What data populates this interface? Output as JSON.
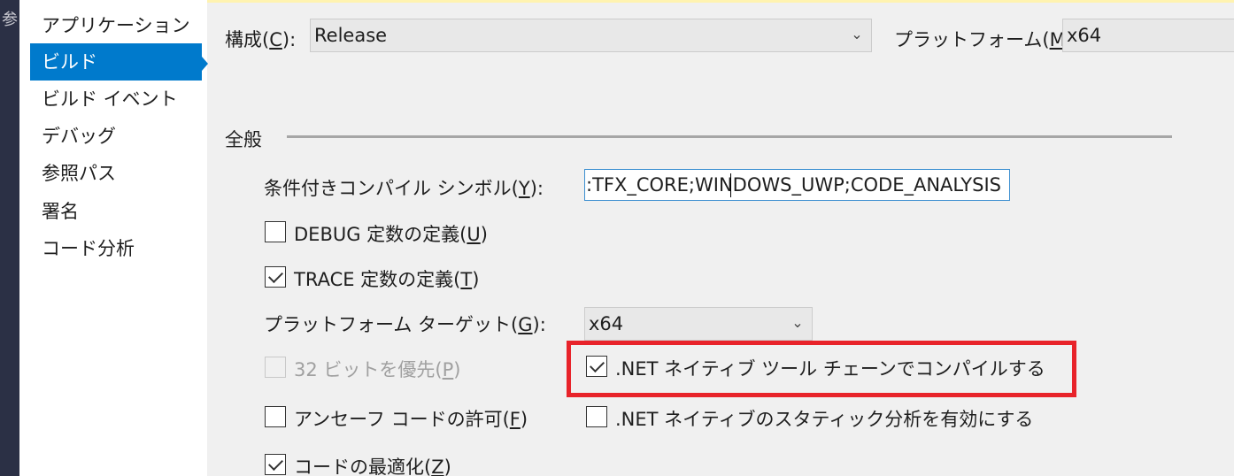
{
  "sidebar": {
    "items": [
      {
        "label": "アプリケーション"
      },
      {
        "label": "ビルド"
      },
      {
        "label": "ビルド イベント"
      },
      {
        "label": "デバッグ"
      },
      {
        "label": "参照パス"
      },
      {
        "label": "署名"
      },
      {
        "label": "コード分析"
      }
    ],
    "selected": "ビルド"
  },
  "left_strip": {
    "glyph": "参"
  },
  "toolbar": {
    "config_label": "構成(",
    "config_key": "C",
    "config_label_end": "):",
    "config_value": "Release",
    "platform_label": "プラットフォーム(",
    "platform_key": "M",
    "platform_label_end": "):",
    "platform_value": "x64"
  },
  "general": {
    "section_title": "全般",
    "symbols_label": "条件付きコンパイル シンボル(",
    "symbols_key": "Y",
    "symbols_label_end": "):",
    "symbols_value": ":TFX_CORE;WINDOWS_UWP;CODE_ANALYSIS",
    "debug_label": "DEBUG 定数の定義(",
    "debug_key": "U",
    "debug_label_end": ")",
    "debug_checked": false,
    "trace_label": "TRACE 定数の定義(",
    "trace_key": "T",
    "trace_label_end": ")",
    "trace_checked": true,
    "target_label": "プラットフォーム ターゲット(",
    "target_key": "G",
    "target_label_end": "):",
    "target_value": "x64",
    "prefer32_label": "32 ビットを優先(",
    "prefer32_key": "P",
    "prefer32_label_end": ")",
    "prefer32_checked": false,
    "prefer32_enabled": false,
    "native_label": ".NET ネイティブ ツール チェーンでコンパイルする",
    "native_checked": true,
    "unsafe_label": "アンセーフ コードの許可(",
    "unsafe_key": "F",
    "unsafe_label_end": ")",
    "unsafe_checked": false,
    "static_label": ".NET ネイティブのスタティック分析を有効にする",
    "static_checked": false,
    "optimize_label": "コードの最適化(",
    "optimize_key": "Z",
    "optimize_label_end": ")",
    "optimize_checked": true
  },
  "icons": {
    "chevron": "chevron-down-icon",
    "checkbox": "checkbox-icon"
  },
  "colors": {
    "accent": "#007acc",
    "highlight": "#e8232a",
    "focus_border": "#3c8fd0"
  }
}
